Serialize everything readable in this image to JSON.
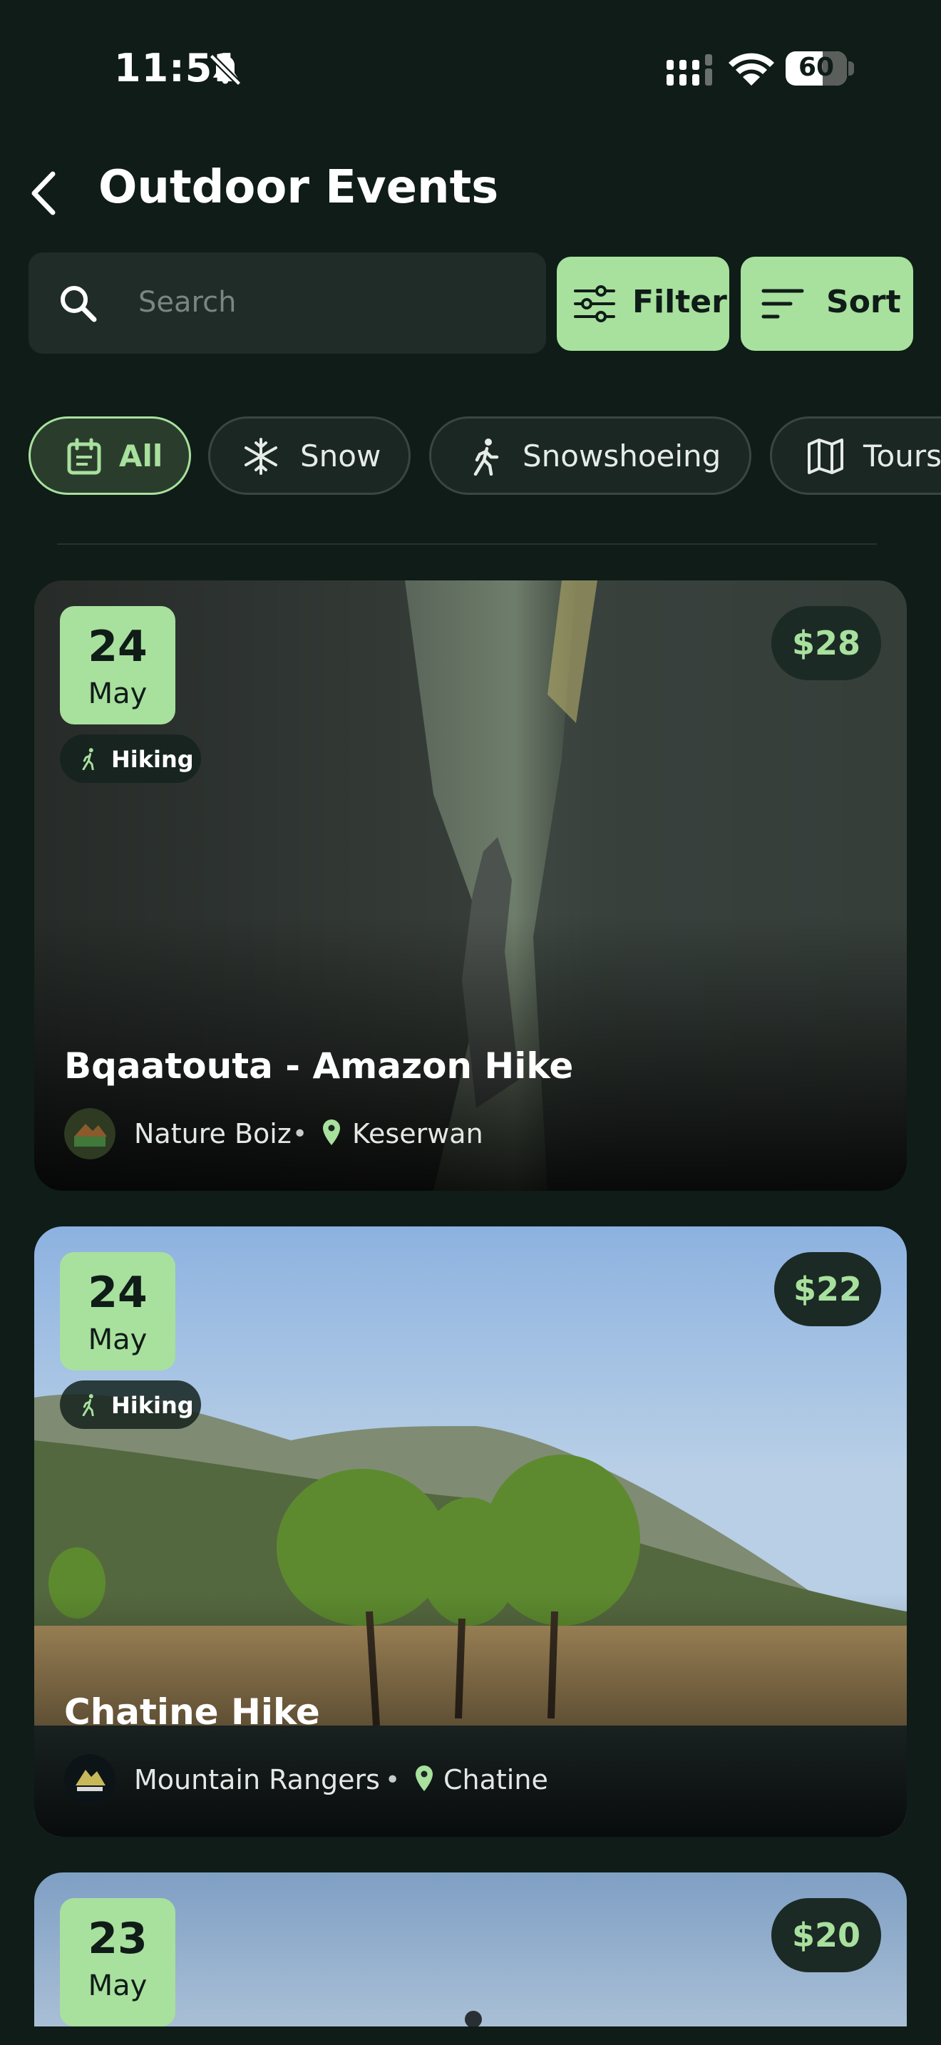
{
  "status_bar": {
    "time": "11:51",
    "battery": "60"
  },
  "header": {
    "title": "Outdoor Events"
  },
  "search": {
    "placeholder": "Search",
    "value": ""
  },
  "toolbar": {
    "filter_label": "Filter",
    "sort_label": "Sort"
  },
  "categories": [
    {
      "label": "All",
      "icon": "calendar-icon",
      "active": true
    },
    {
      "label": "Snow",
      "icon": "snowflake-icon",
      "active": false
    },
    {
      "label": "Snowshoeing",
      "icon": "hiker-icon",
      "active": false
    },
    {
      "label": "Tours",
      "icon": "map-icon",
      "active": false
    }
  ],
  "events": [
    {
      "day": "24",
      "month": "May",
      "tag": "Hiking",
      "price": "$28",
      "title": "Bqaatouta - Amazon Hike",
      "organizer": "Nature Boiz",
      "location": "Keserwan"
    },
    {
      "day": "24",
      "month": "May",
      "tag": "Hiking",
      "price": "$22",
      "title": "Chatine Hike",
      "organizer": "Mountain Rangers",
      "location": "Chatine"
    },
    {
      "day": "23",
      "month": "May",
      "tag": "",
      "price": "$20",
      "title": "",
      "organizer": "",
      "location": ""
    }
  ],
  "colors": {
    "background": "#0f1c18",
    "accent": "#a8e09d",
    "surface": "#1f2c28"
  }
}
